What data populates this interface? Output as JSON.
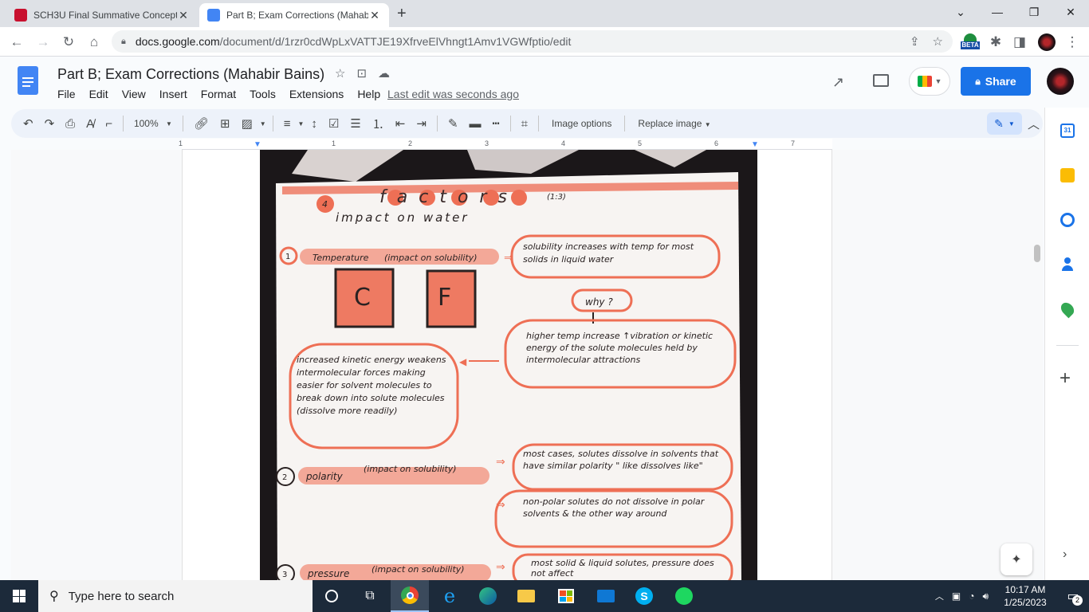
{
  "browser": {
    "tabs": [
      {
        "title": "SCH3U Final Summative Concept",
        "favicon_color": "#c8102e",
        "active": false
      },
      {
        "title": "Part B; Exam Corrections (Mahabi",
        "favicon_color": "#4285f4",
        "active": true
      }
    ],
    "url_domain": "docs.google.com",
    "url_path": "/document/d/1rzr0cdWpLxVATTJE19XfrveElVhngt1Amv1VGWfptio/edit",
    "beta_label": "BETA"
  },
  "docs": {
    "title": "Part B; Exam Corrections (Mahabir Bains)",
    "menu": [
      "File",
      "Edit",
      "View",
      "Insert",
      "Format",
      "Tools",
      "Extensions",
      "Help"
    ],
    "last_edit": "Last edit was seconds ago",
    "share_label": "Share",
    "toolbar": {
      "zoom": "100%",
      "image_options": "Image options",
      "replace_image": "Replace image"
    },
    "ruler_numbers": [
      "1",
      "1",
      "2",
      "3",
      "4",
      "5",
      "6",
      "7"
    ],
    "calendar_day": "31"
  },
  "photo_notes": {
    "heading_numeral": "4",
    "heading": "factors",
    "heading_ref": "(1:3)",
    "subheading": "impact on water",
    "temperature": {
      "num": "1",
      "label": "Temperature",
      "impact": "(impact on solubility)",
      "result": "solubility increases with temp for most solids in liquid water",
      "why": "why ?",
      "reason": "higher temp increase ↑vibration or kinetic energy of the solute molecules held by intermolecular attractions",
      "effect": "increased kinetic energy weakens intermolecular forces making easier for solvent molecules to break down into solute molecules (dissolve more readily)",
      "box_c": "C",
      "box_f": "F"
    },
    "polarity": {
      "num": "2",
      "label": "polarity",
      "impact": "(impact on solubility)",
      "result1": "most cases, solutes dissolve in solvents that have similar polarity \" like dissolves like\"",
      "result2": "non-polar solutes do not dissolve in polar solvents & the other way around"
    },
    "pressure": {
      "num": "3",
      "label": "pressure",
      "impact": "(impact on solubility)",
      "result": "most solid & liquid solutes, pressure does not affect"
    }
  },
  "taskbar": {
    "search_placeholder": "Type here to search",
    "time": "10:17 AM",
    "date": "1/25/2023",
    "notifications": "2",
    "skype_letter": "S"
  }
}
